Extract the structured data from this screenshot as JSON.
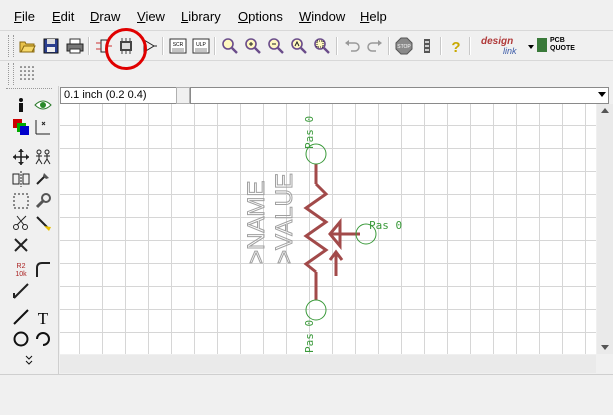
{
  "menu": {
    "items": [
      {
        "label": "File",
        "accel": "F",
        "rest": "ile"
      },
      {
        "label": "Edit",
        "accel": "E",
        "rest": "dit"
      },
      {
        "label": "Draw",
        "accel": "D",
        "rest": "raw"
      },
      {
        "label": "View",
        "accel": "V",
        "rest": "iew"
      },
      {
        "label": "Library",
        "accel": "L",
        "rest": "ibrary"
      },
      {
        "label": "Options",
        "accel": "O",
        "rest": "ptions"
      },
      {
        "label": "Window",
        "accel": "W",
        "rest": "indow"
      },
      {
        "label": "Help",
        "accel": "H",
        "rest": "elp"
      }
    ]
  },
  "toolbar": {
    "icons": [
      "open-icon",
      "save-icon",
      "print-icon",
      "schematic-icon",
      "package-icon",
      "symbol-icon",
      "script-icon",
      "ulp-icon",
      "zoom-fit-icon",
      "zoom-in-icon",
      "zoom-out-icon",
      "zoom-redraw-icon",
      "zoom-select-icon",
      "undo-icon",
      "redo-icon",
      "stop-icon",
      "go-icon",
      "help-icon"
    ],
    "scr_label": "SCR",
    "ulp_label": "ULP",
    "stop_label": "STOP",
    "help_label": "?",
    "designlink_label_1": "design",
    "designlink_label_2": "link",
    "pcbquote_label_1": "PCB",
    "pcbquote_label_2": "QUOTE"
  },
  "coord": {
    "value": "0.1 inch (0.2 0.4)"
  },
  "symbol": {
    "name_text": ">NAME",
    "value_text": ">VALUE",
    "pin_top": "Pas 0",
    "pin_right": "Pas 0",
    "pin_bottom": "Pas 0"
  },
  "left_tools": {
    "icons": [
      "info-icon",
      "eye-icon",
      "layers-icon",
      "mark-icon",
      "move-icon",
      "copy-icon",
      "mirror-icon",
      "rotate-icon",
      "group-icon",
      "change-icon",
      "cut-icon",
      "paste-icon",
      "delete-icon",
      "name-icon",
      "value-icon",
      "miter-icon",
      "split-icon",
      "wire-icon",
      "text-icon",
      "circle-icon",
      "arc-icon",
      "more-icon"
    ],
    "name_label": "R2",
    "value_label": "10k",
    "text_label": "T"
  },
  "colors": {
    "schematic_red": "#a24a4a",
    "pin_green": "#3a9a3a",
    "label_gray": "#a0a0a0",
    "callout_red": "#e00000"
  }
}
